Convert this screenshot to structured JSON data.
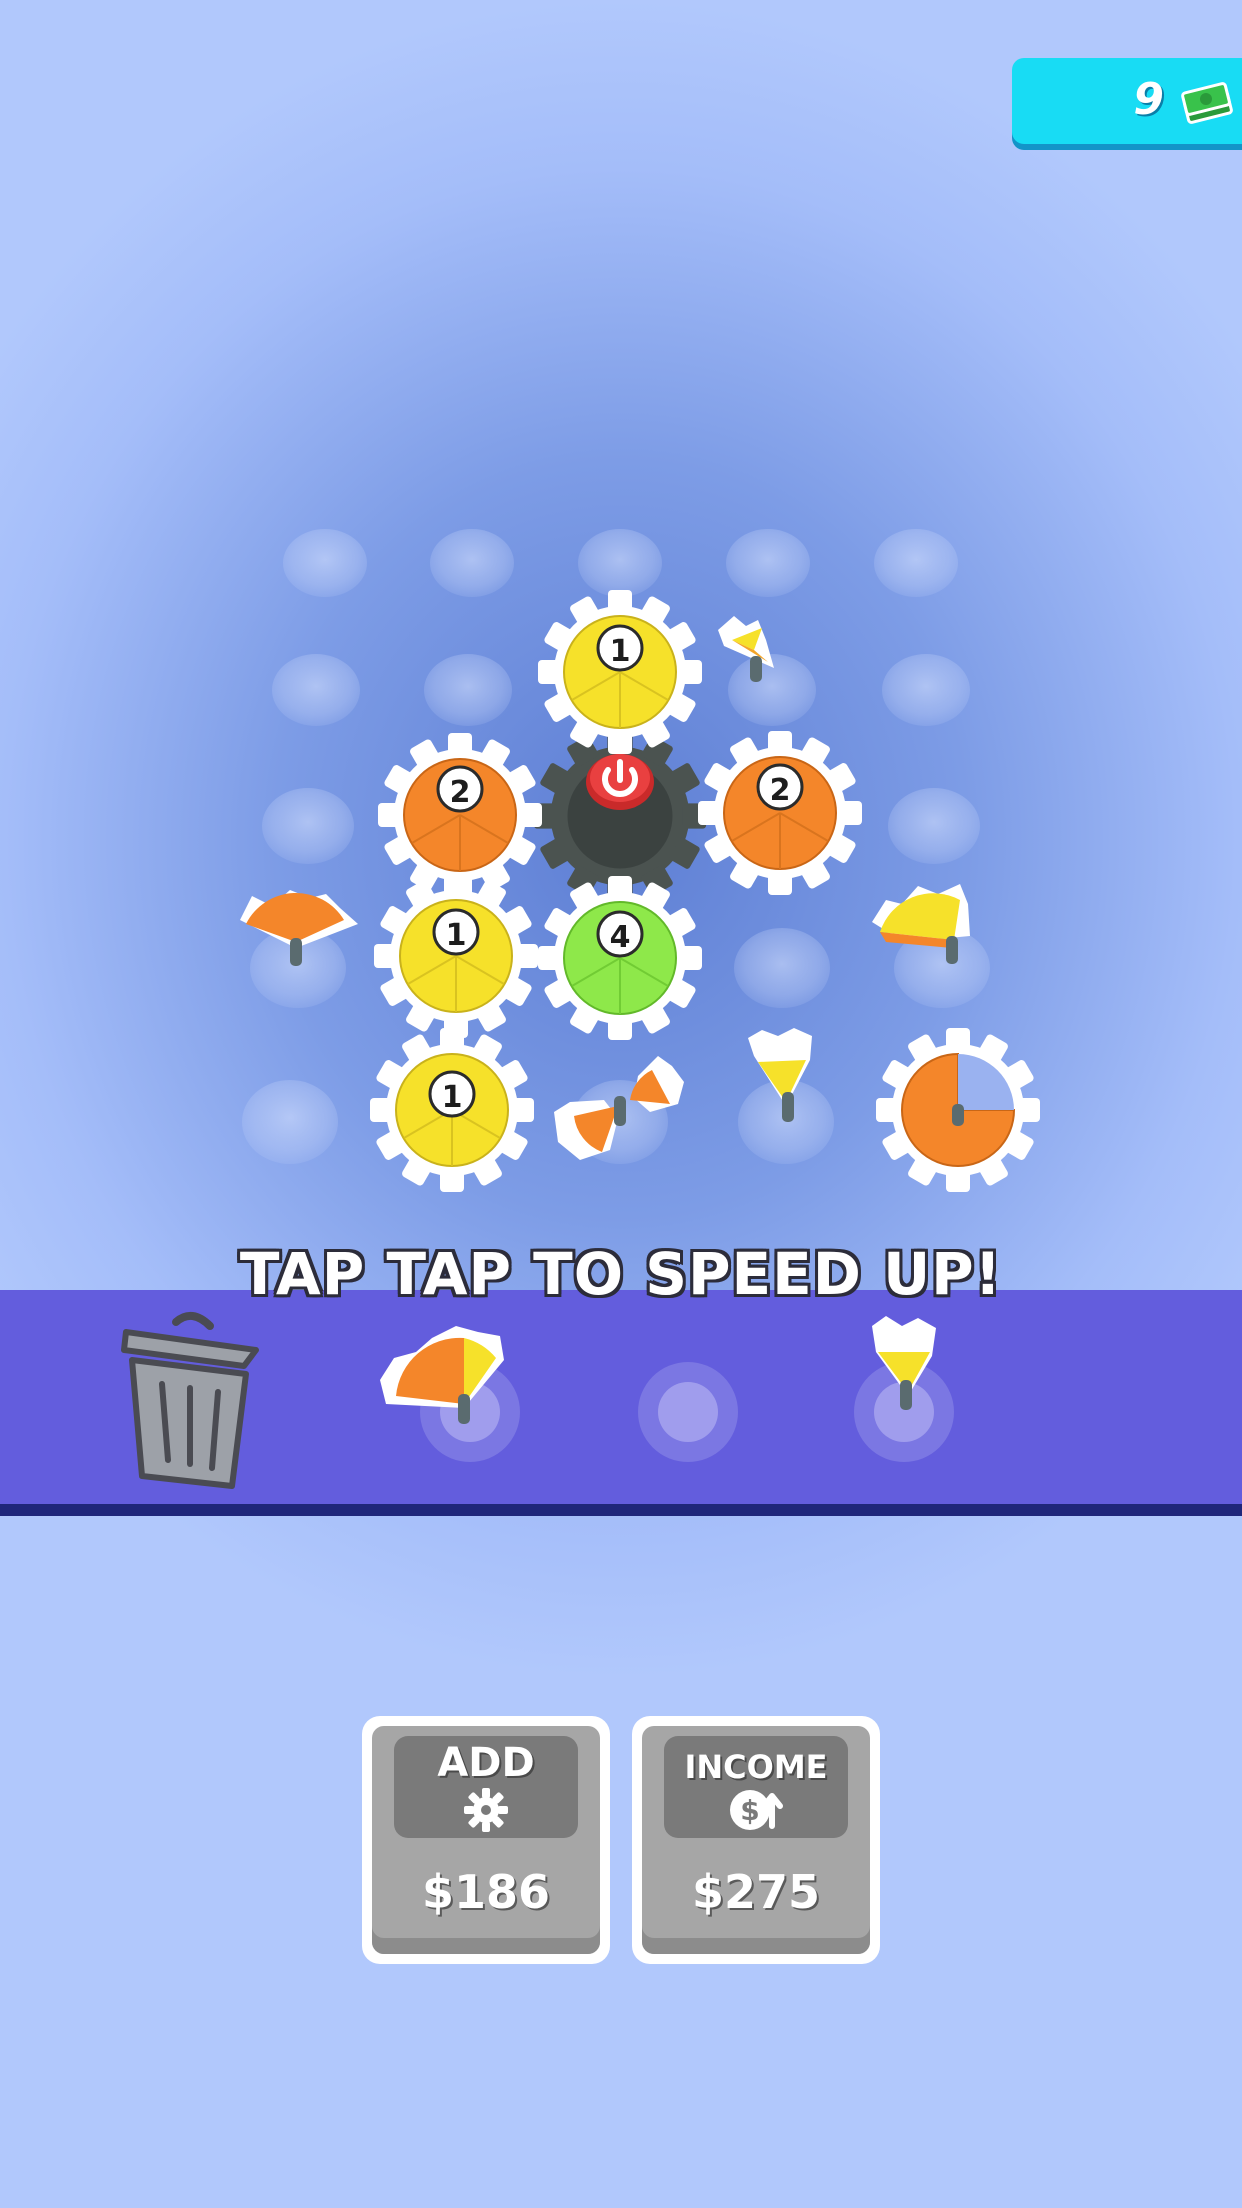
{
  "currency": {
    "value": "9",
    "icon": "cash-stack-icon"
  },
  "board": {
    "gears": [
      {
        "level": "1",
        "color": "#f6e12a"
      },
      {
        "level": "2",
        "color": "#f4862a"
      },
      {
        "level": "2",
        "color": "#f4862a"
      },
      {
        "level": "1",
        "color": "#f6e12a"
      },
      {
        "level": "4",
        "color": "#8ee84a"
      },
      {
        "level": "1",
        "color": "#f6e12a"
      }
    ],
    "power_icon": "power-icon"
  },
  "hint": "TAP TAP TO SPEED UP!",
  "tray": {
    "trash_icon": "trash-can-icon"
  },
  "shop": {
    "add": {
      "title": "ADD",
      "icon": "gear-icon",
      "price": "$186"
    },
    "income": {
      "title": "INCOME",
      "icon": "dollar-up-icon",
      "price": "$275"
    }
  },
  "colors": {
    "yellow": "#f6e12a",
    "orange": "#f4862a",
    "green": "#8ee84a",
    "tray": "#635ddd",
    "currency_bg": "#18dcf4"
  }
}
